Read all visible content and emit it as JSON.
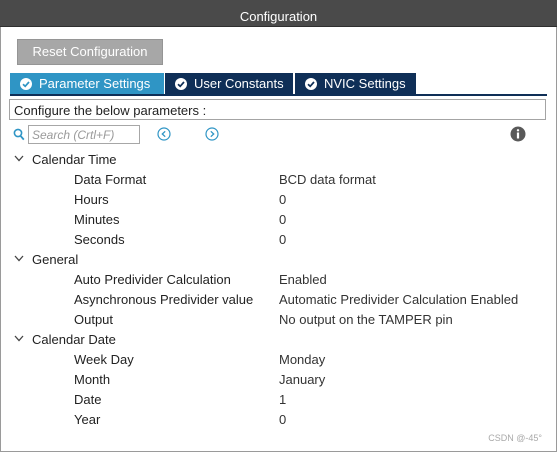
{
  "window": {
    "title": "Configuration"
  },
  "toolbar": {
    "reset_label": "Reset Configuration"
  },
  "tabs": [
    {
      "label": "Parameter Settings",
      "active": true,
      "icon": "check-circle-icon"
    },
    {
      "label": "User Constants",
      "active": false,
      "icon": "check-circle-icon"
    },
    {
      "label": "NVIC Settings",
      "active": false,
      "icon": "check-circle-icon"
    }
  ],
  "description": "Configure the below parameters :",
  "search": {
    "placeholder": "Search (Crtl+F)",
    "value": ""
  },
  "groups": [
    {
      "label": "Calendar Time",
      "params": [
        {
          "label": "Data Format",
          "value": "BCD data format"
        },
        {
          "label": "Hours",
          "value": "0"
        },
        {
          "label": "Minutes",
          "value": "0"
        },
        {
          "label": "Seconds",
          "value": "0"
        }
      ]
    },
    {
      "label": "General",
      "params": [
        {
          "label": "Auto Predivider Calculation",
          "value": "Enabled"
        },
        {
          "label": "Asynchronous Predivider value",
          "value": "Automatic Predivider Calculation Enabled"
        },
        {
          "label": "Output",
          "value": "No output on the TAMPER pin"
        }
      ]
    },
    {
      "label": "Calendar Date",
      "params": [
        {
          "label": "Week Day",
          "value": "Monday"
        },
        {
          "label": "Month",
          "value": "January"
        },
        {
          "label": "Date",
          "value": "1"
        },
        {
          "label": "Year",
          "value": "0"
        }
      ]
    }
  ],
  "watermark": "CSDN @-45°",
  "colors": {
    "titlebar": "#4a4a4a",
    "tab_active": "#2f95c5",
    "tab_inactive": "#0f2f57",
    "icon_accent": "#2f95c5",
    "reset_button": "#a7a7a7"
  }
}
